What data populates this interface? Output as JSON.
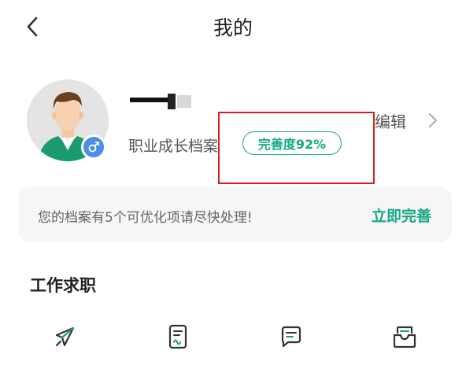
{
  "header": {
    "title": "我的",
    "back_icon": "chevron-left-icon"
  },
  "profile": {
    "avatar_icon": "user-avatar-male",
    "gender_icon": "male-icon",
    "subtitle": "职业成长档案",
    "completeness_label": "完善度92%",
    "completeness": 0.92,
    "edit_label": "编辑",
    "edit_icon": "chevron-right-icon"
  },
  "notice": {
    "text": "您的档案有5个可优化项请尽快处理!",
    "action_label": "立即完善"
  },
  "section": {
    "title": "工作求职"
  },
  "quick_icons": [
    {
      "icon": "paper-plane-icon"
    },
    {
      "icon": "resume-document-icon"
    },
    {
      "icon": "message-icon"
    },
    {
      "icon": "inbox-icon"
    }
  ],
  "colors": {
    "accent": "#16a884",
    "highlight": "#d22121",
    "gender_badge": "#4a8ee6",
    "notice_bg": "#f4f6f7"
  }
}
